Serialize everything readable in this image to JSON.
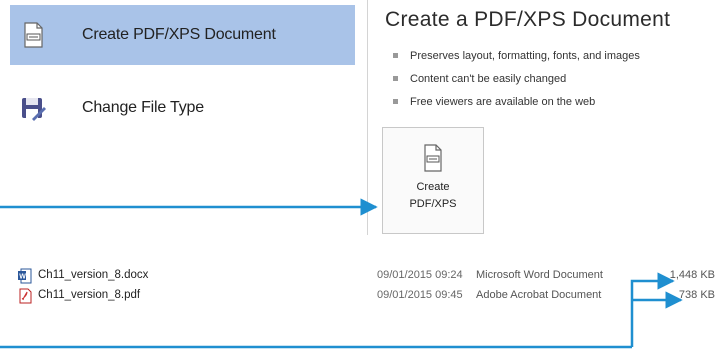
{
  "export_menu": {
    "items": [
      {
        "label": "Create PDF/XPS Document",
        "icon": "pdf-document-icon",
        "selected": true
      },
      {
        "label": "Change File Type",
        "icon": "save-as-icon",
        "selected": false
      }
    ]
  },
  "detail": {
    "title": "Create a PDF/XPS Document",
    "bullets": [
      "Preserves layout, formatting, fonts, and images",
      "Content can't be easily changed",
      "Free viewers are available on the web"
    ],
    "button_line1": "Create",
    "button_line2": "PDF/XPS"
  },
  "files": [
    {
      "name": "Ch11_version_8.docx",
      "modified": "09/01/2015 09:24",
      "type": "Microsoft Word Document",
      "size": "1,448 KB",
      "icon": "word-document-icon"
    },
    {
      "name": "Ch11_version_8.pdf",
      "modified": "09/01/2015 09:45",
      "type": "Adobe Acrobat Document",
      "size": "738 KB",
      "icon": "pdf-file-icon"
    }
  ],
  "colors": {
    "selection": "#a9c3e8",
    "arrow": "#1f8fd0"
  }
}
